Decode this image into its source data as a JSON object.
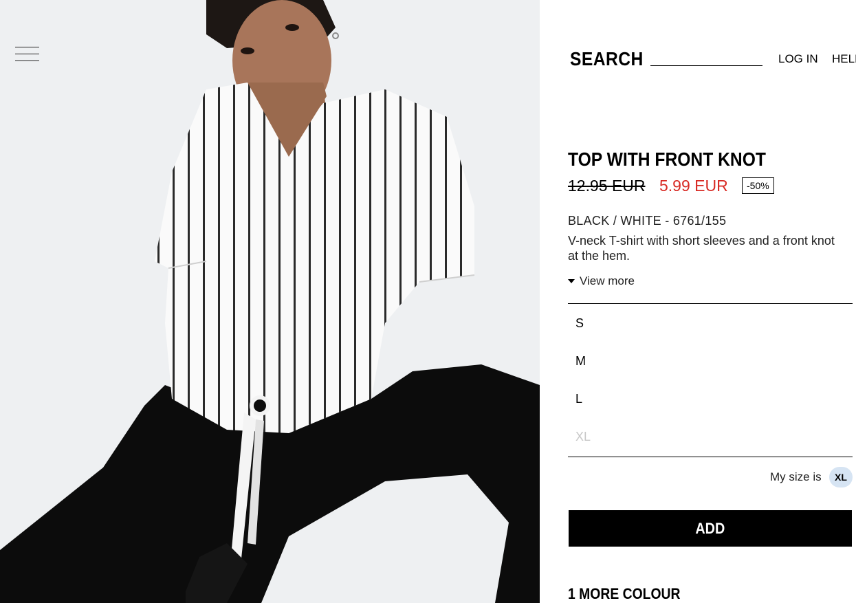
{
  "header": {
    "search_label": "SEARCH",
    "login_label": "LOG IN",
    "help_label": "HELP"
  },
  "product": {
    "title": "TOP WITH FRONT KNOT",
    "old_price": "12.95 EUR",
    "new_price": "5.99 EUR",
    "discount": "-50%",
    "color_ref": "BLACK / WHITE - 6761/155",
    "description": "V-neck T-shirt with short sleeves and a front knot at the hem.",
    "view_more": "View more"
  },
  "sizes": [
    {
      "label": "S",
      "available": true
    },
    {
      "label": "M",
      "available": true
    },
    {
      "label": "L",
      "available": true
    },
    {
      "label": "XL",
      "available": false
    }
  ],
  "my_size": {
    "label": "My size is",
    "value": "XL"
  },
  "add_button": "ADD",
  "more_colours": "1 MORE COLOUR",
  "colors": {
    "sale_price": "#d82a24",
    "my_size_badge": "#d6e4f3",
    "disabled_size": "#c8c8c8"
  }
}
